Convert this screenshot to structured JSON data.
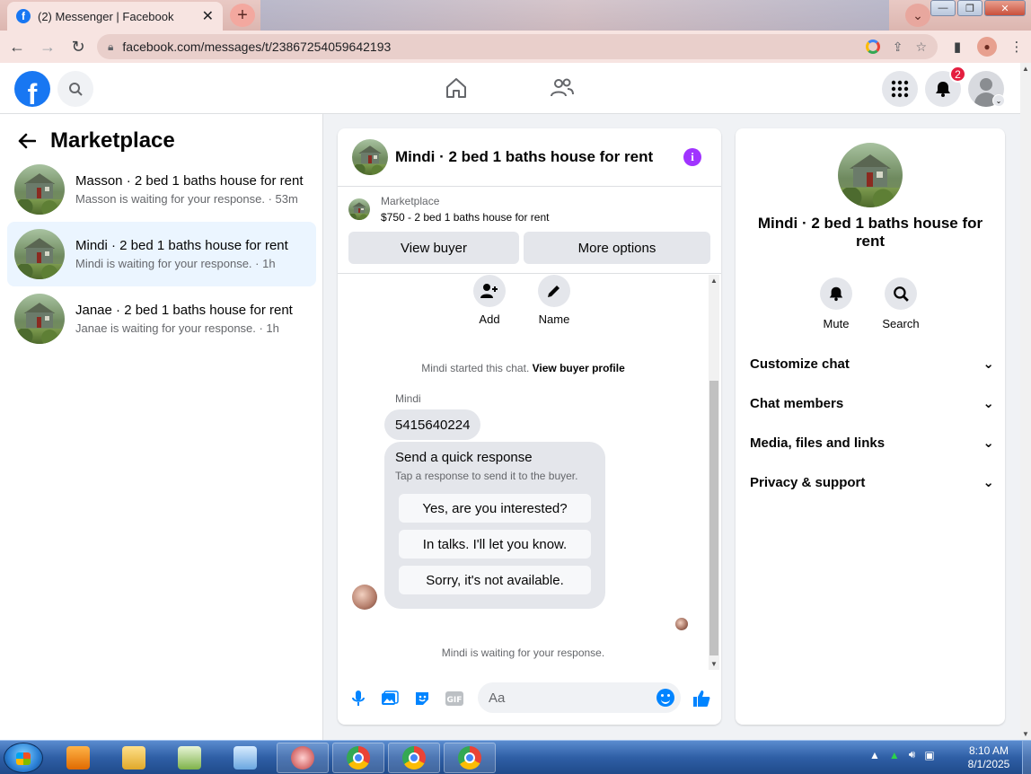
{
  "browser": {
    "tab_title": "(2) Messenger | Facebook",
    "url": "facebook.com/messages/t/23867254059642193"
  },
  "header": {
    "notifications_count": "2"
  },
  "sidebar": {
    "title": "Marketplace",
    "threads": [
      {
        "name": "Masson · 2 bed 1 baths house for rent",
        "sub": "Masson is waiting for your response. · 53m",
        "active": false
      },
      {
        "name": "Mindi · 2 bed 1 baths house for rent",
        "sub": "Mindi is waiting for your response. · 1h",
        "active": true
      },
      {
        "name": "Janae · 2 bed 1 baths house for rent",
        "sub": "Janae is waiting for your response. · 1h",
        "active": false
      }
    ]
  },
  "chat": {
    "title": "Mindi · 2 bed 1 baths house for rent",
    "listing_category": "Marketplace",
    "listing_price": "$750 - 2 bed 1 baths house for rent",
    "view_buyer": "View buyer",
    "more_options": "More options",
    "add_label": "Add",
    "name_label": "Name",
    "started_text": "Mindi started this chat.",
    "view_profile": "View buyer profile",
    "sender": "Mindi",
    "phone_msg": "5415640224",
    "quick_title": "Send a quick response",
    "quick_sub": "Tap a response to send it to the buyer.",
    "quick_options": [
      "Yes, are you interested?",
      "In talks. I'll let you know.",
      "Sorry, it's not available."
    ],
    "waiting_text": "Mindi is waiting for your response.",
    "composer_placeholder": "Aa"
  },
  "right_panel": {
    "title": "Mindi · 2 bed 1 baths house for rent",
    "mute_label": "Mute",
    "search_label": "Search",
    "rows": [
      "Customize chat",
      "Chat members",
      "Media, files and links",
      "Privacy & support"
    ]
  },
  "taskbar": {
    "time": "8:10 AM",
    "date": "8/1/2025"
  },
  "colors": {
    "fb_blue": "#1877f2",
    "messenger_blue": "#0084ff",
    "info_purple": "#a033ff",
    "badge_red": "#e41e3f"
  }
}
